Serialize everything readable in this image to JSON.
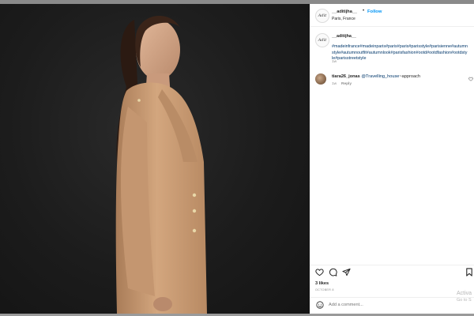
{
  "post": {
    "username": "__aditijha__",
    "follow_label": "Follow",
    "location": "Paris, France",
    "caption_user": "__aditijha__",
    "caption_text": "#madeinfrance#madeinparis#paris#paris#parisstyle#parisienne#autumnstyle#autumnoutfit#autumnlook#parisfashion#ootd#ootdfashion#ootdstyle#parisstreetstyle",
    "caption_time": "1w",
    "likes": "3 likes",
    "date": "OCTOBER 8",
    "add_comment_placeholder": "Add a comment..."
  },
  "comments": [
    {
      "user": "tiara26_jonas",
      "mention": "@Travelling_house",
      "text": "~approach",
      "time": "1w",
      "reply_label": "Reply"
    }
  ],
  "watermark": {
    "line1": "Activa",
    "line2": "Go to S"
  },
  "colors": {
    "link_blue": "#0095f6",
    "hashtag_navy": "#00376b",
    "text_dark": "#262626",
    "muted_gray": "#8e8e8e",
    "coat": "#c89a72"
  },
  "icons": [
    "heart-icon",
    "comment-icon",
    "share-icon",
    "bookmark-icon",
    "emoji-icon",
    "like-comment-heart-icon"
  ]
}
